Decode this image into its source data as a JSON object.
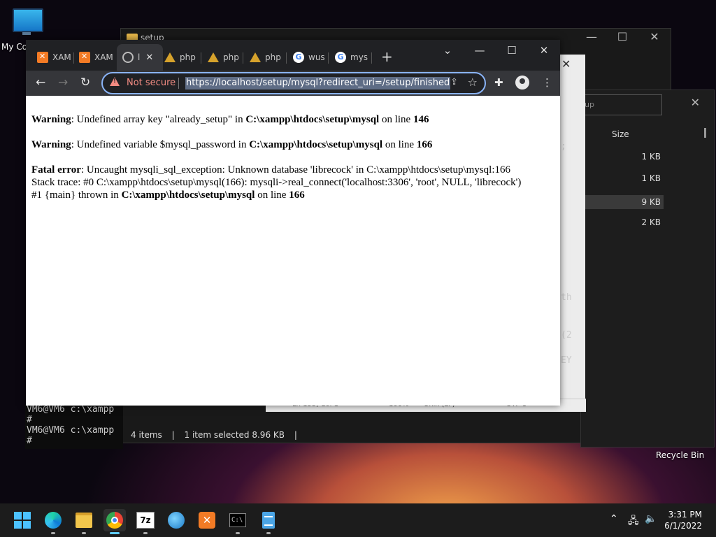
{
  "desktop": {
    "this_pc_label": "My Co",
    "recycle_bin_label": "Recycle Bin"
  },
  "explorer": {
    "title": "setup",
    "status_items": "4 items",
    "status_selected": "1 item selected  8.96 KB",
    "size_header": "Size",
    "search_placeholder": "up",
    "file_sizes": [
      "1 KB",
      "1 KB",
      "9 KB",
      "2 KB"
    ]
  },
  "notepad": {
    "status_position": "Ln 155, Col 1",
    "status_zoom": "100%",
    "status_eol": "Unix (LF)",
    "status_encoding": "UTF-8"
  },
  "console_fragments": [
    ";",
    "th",
    "(2",
    "EY"
  ],
  "cmd": {
    "lines": [
      "VM6@VM6 c:\\xampp",
      "#",
      "VM6@VM6 c:\\xampp",
      "#"
    ]
  },
  "chrome": {
    "tabs": [
      {
        "label": "XAM",
        "icon": "xampp-icon"
      },
      {
        "label": "XAM",
        "icon": "xampp-icon"
      },
      {
        "label": "l",
        "icon": "globe-icon",
        "active": true
      },
      {
        "label": "php",
        "icon": "php-icon"
      },
      {
        "label": "php",
        "icon": "php-icon"
      },
      {
        "label": "php",
        "icon": "php-icon"
      },
      {
        "label": "wus",
        "icon": "google-icon"
      },
      {
        "label": "mys",
        "icon": "google-icon"
      }
    ],
    "not_secure": "Not secure",
    "url": "https://localhost/setup/mysql?redirect_uri=/setup/finished"
  },
  "page": {
    "w1_label": "Warning",
    "w1_text": ": Undefined array key \"already_setup\" in ",
    "w1_path": "C:\\xampp\\htdocs\\setup\\mysql",
    "w1_online": " on line ",
    "w1_line": "146",
    "w2_label": "Warning",
    "w2_text": ": Undefined variable $mysql_password in ",
    "w2_path": "C:\\xampp\\htdocs\\setup\\mysql",
    "w2_online": " on line ",
    "w2_line": "166",
    "fatal_label": "Fatal error",
    "fatal_text": ": Uncaught mysqli_sql_exception: Unknown database 'librecock' in C:\\xampp\\htdocs\\setup\\mysql:166",
    "stack_line": "Stack trace: #0 C:\\xampp\\htdocs\\setup\\mysql(166): mysqli->real_connect('localhost:3306', 'root', NULL, 'librecock')",
    "thrown_prefix": "#1 {main} thrown in ",
    "thrown_path": "C:\\xampp\\htdocs\\setup\\mysql",
    "thrown_online": " on line ",
    "thrown_line": "166"
  },
  "taskbar": {
    "time": "3:31 PM",
    "date": "6/1/2022",
    "seven_zip_label": "7z"
  },
  "colors": {
    "accent": "#8ab4f8",
    "not_secure": "#f28b82",
    "xampp": "#f37b25"
  }
}
